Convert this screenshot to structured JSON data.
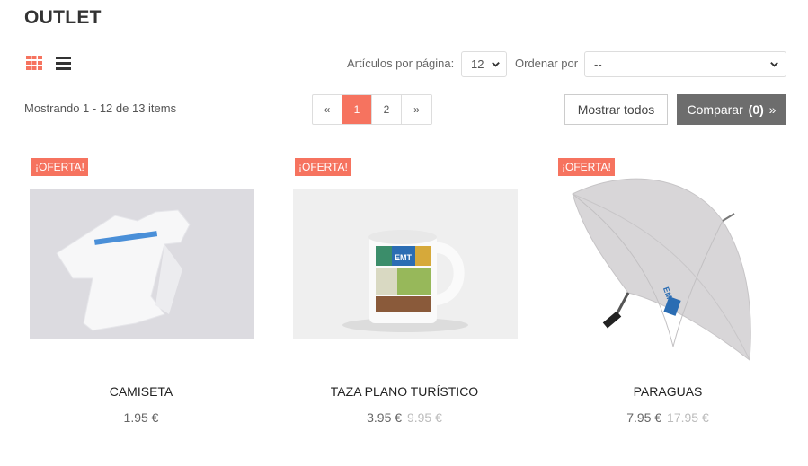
{
  "page": {
    "title": "OUTLET"
  },
  "toolbar": {
    "per_page_label": "Artículos por página:",
    "per_page_value": "12",
    "sort_label": "Ordenar por",
    "sort_value": "--",
    "view_modes": [
      "grid-icon",
      "list-icon"
    ],
    "active_view": "grid"
  },
  "results": {
    "showing": "Mostrando 1 - 12 de 13 items"
  },
  "pagination": {
    "prev": "«",
    "pages": [
      "1",
      "2"
    ],
    "active": "1",
    "next": "»"
  },
  "actions": {
    "show_all": "Mostrar todos",
    "compare_prefix": "Comparar",
    "compare_count": "(0)",
    "compare_suffix": "»"
  },
  "products": [
    {
      "badge": "¡OFERTA!",
      "name": "CAMISETA",
      "price": "1.95 €",
      "old_price": ""
    },
    {
      "badge": "¡OFERTA!",
      "name": "TAZA PLANO TURÍSTICO",
      "price": "3.95 €",
      "old_price": "9.95 €"
    },
    {
      "badge": "¡OFERTA!",
      "name": "PARAGUAS",
      "price": "7.95 €",
      "old_price": "17.95 €"
    }
  ],
  "colors": {
    "accent": "#f6735f",
    "compare_bg": "#6d6d6d",
    "text": "#333333"
  }
}
